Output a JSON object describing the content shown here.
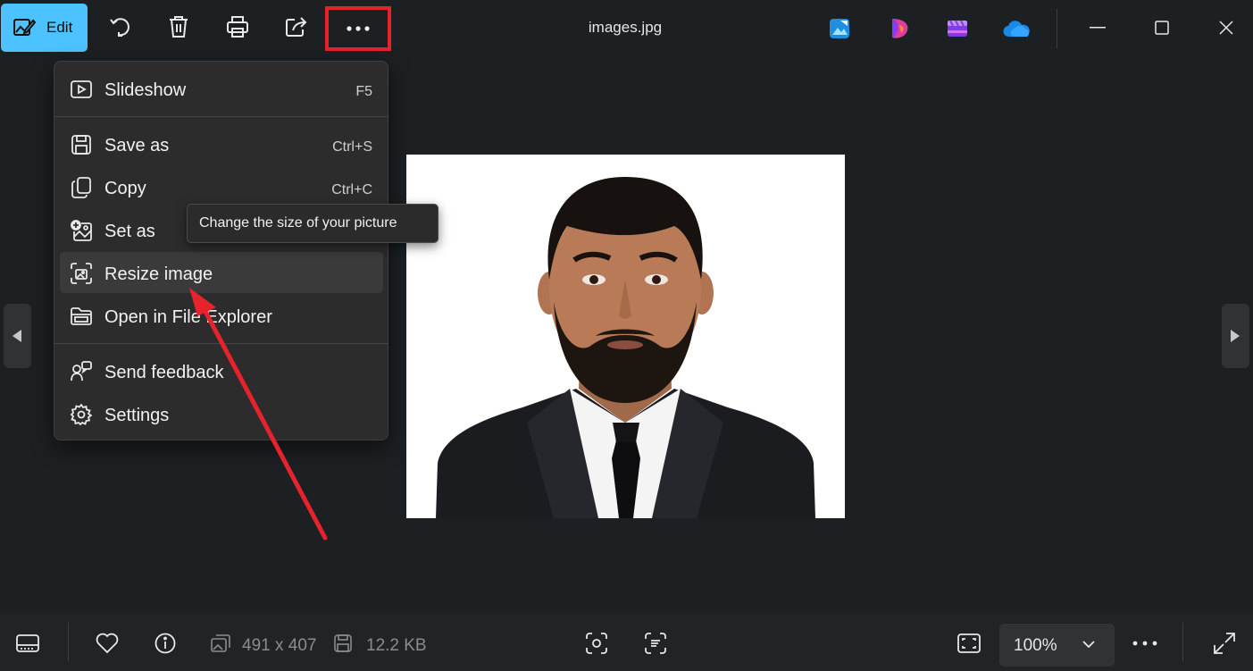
{
  "toolbar": {
    "edit_label": "Edit",
    "window_title": "images.jpg"
  },
  "menu": {
    "items": [
      {
        "label": "Slideshow",
        "shortcut": "F5"
      },
      {
        "label": "Save as",
        "shortcut": "Ctrl+S"
      },
      {
        "label": "Copy",
        "shortcut": "Ctrl+C"
      },
      {
        "label": "Set as",
        "shortcut": ""
      },
      {
        "label": "Resize image",
        "shortcut": ""
      },
      {
        "label": "Open in File Explorer",
        "shortcut": ""
      },
      {
        "label": "Send feedback",
        "shortcut": ""
      },
      {
        "label": "Settings",
        "shortcut": ""
      }
    ],
    "tooltip": "Change the size of your picture",
    "hovered_item": "Resize image"
  },
  "statusbar": {
    "dimensions": "491 x 407",
    "file_size": "12.2 KB",
    "zoom": "100%"
  },
  "colors": {
    "accent": "#4cc2ff",
    "highlight_box": "#e6232c",
    "annotation_arrow": "#e6232c",
    "background": "#1c2023"
  }
}
